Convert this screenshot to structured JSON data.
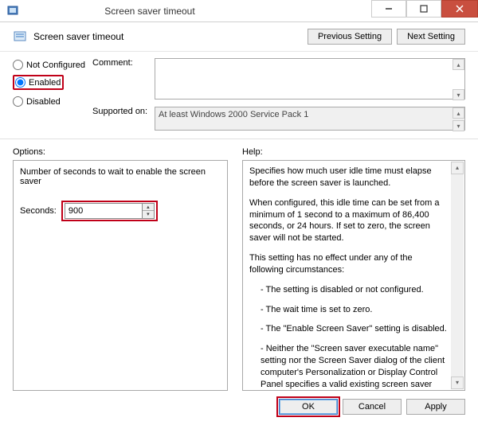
{
  "window": {
    "title": "Screen saver timeout"
  },
  "header": {
    "title": "Screen saver timeout",
    "previous_label": "Previous Setting",
    "next_label": "Next Setting"
  },
  "radios": {
    "not_configured": "Not Configured",
    "enabled": "Enabled",
    "disabled": "Disabled",
    "selected": "enabled"
  },
  "comment": {
    "label": "Comment:",
    "value": ""
  },
  "supported": {
    "label": "Supported on:",
    "value": "At least Windows 2000 Service Pack 1"
  },
  "options": {
    "section_label": "Options:",
    "desc": "Number of seconds to wait to enable the screen saver",
    "seconds_label": "Seconds:",
    "seconds_value": "900"
  },
  "help": {
    "section_label": "Help:",
    "p1": "Specifies how much user idle time must elapse before the screen saver is launched.",
    "p2": "When configured, this idle time can be set from a minimum of 1 second to a maximum of 86,400 seconds, or 24 hours. If set to zero, the screen saver will not be started.",
    "p3": "This setting has no effect under any of the following circumstances:",
    "b1": "- The setting is disabled or not configured.",
    "b2": "- The wait time is set to zero.",
    "b3": "- The \"Enable Screen Saver\" setting is disabled.",
    "b4": "- Neither the \"Screen saver executable name\" setting nor the Screen Saver dialog of the client computer's Personalization or Display Control Panel specifies a valid existing screen saver program on the client."
  },
  "footer": {
    "ok": "OK",
    "cancel": "Cancel",
    "apply": "Apply"
  }
}
